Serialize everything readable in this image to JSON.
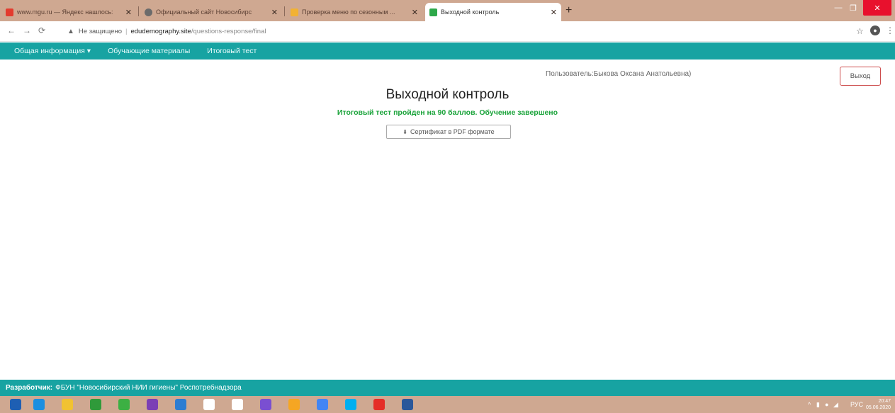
{
  "browser": {
    "tabs": [
      {
        "title": "www.mgu.ru — Яндекс нашлось:",
        "favicon_color": "#e33b2e",
        "active": false
      },
      {
        "title": "Официальный сайт Новосибирс",
        "favicon_color": "#6b6b6b",
        "active": false
      },
      {
        "title": "Проверка меню по сезонным ...",
        "favicon_color": "#f2b233",
        "active": false
      },
      {
        "title": "Выходной контроль",
        "favicon_color": "#2da84a",
        "active": true
      }
    ],
    "address": {
      "security_label": "Не защищено",
      "host": "edudemography.site",
      "path": "/questions-response/final"
    }
  },
  "site": {
    "nav": [
      "Общая информация ▾",
      "Обучающие материалы",
      "Итоговый тест"
    ],
    "user_label": "Пользователь:Быкова Оксана Анатольевна)",
    "logout_label": "Выход",
    "page_title": "Выходной контроль",
    "result_text": "Итоговый тест пройден на 90 баллов. Обучение завершено",
    "certificate_button": "Сертификат в PDF формате",
    "footer_label": "Разработчик:",
    "footer_text": "ФБУН \"Новосибирский НИИ гигиены\" Роспотребнадзора"
  },
  "taskbar": {
    "icons": [
      "windows-start-icon",
      "internet-explorer-icon",
      "file-explorer-icon",
      "office-icon",
      "utorrent-icon",
      "viber-icon",
      "monitor-icon",
      "document-icon",
      "home-icon",
      "mail-icon",
      "app-icon",
      "chrome-icon",
      "skype-icon",
      "acrobat-icon",
      "word-icon"
    ],
    "icon_colors": [
      "#1e5fb3",
      "#1b8fe0",
      "#f1c232",
      "#2f9a3a",
      "#3cb043",
      "#7b3fb5",
      "#2d7dd2",
      "#ffffff",
      "#ffffff",
      "#7a4fd1",
      "#f5a623",
      "#4285f4",
      "#00aff0",
      "#e52d27",
      "#2b579a"
    ],
    "language": "РУС",
    "time": "20:47",
    "date": "05.06.2020"
  },
  "colors": {
    "brand_teal": "#17a3a2",
    "success_green": "#1aa33a",
    "chrome_frame": "#cfa891"
  }
}
